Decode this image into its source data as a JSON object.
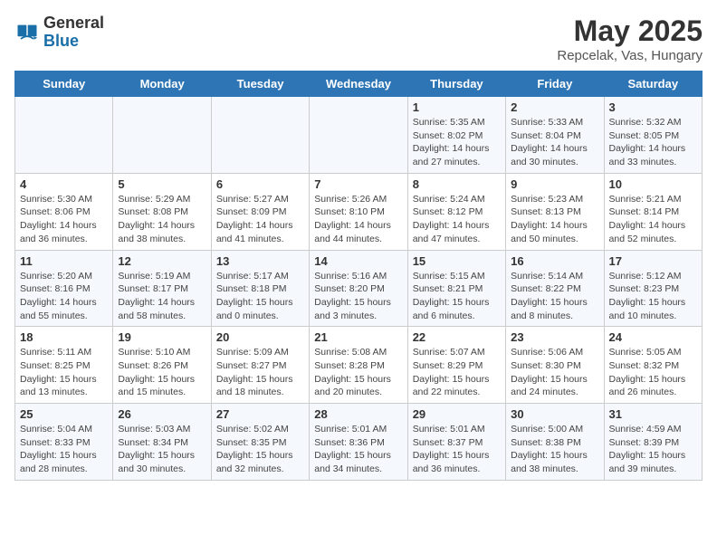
{
  "header": {
    "logo_general": "General",
    "logo_blue": "Blue",
    "title": "May 2025",
    "subtitle": "Repcelak, Vas, Hungary"
  },
  "days_of_week": [
    "Sunday",
    "Monday",
    "Tuesday",
    "Wednesday",
    "Thursday",
    "Friday",
    "Saturday"
  ],
  "weeks": [
    [
      {
        "day": "",
        "detail": ""
      },
      {
        "day": "",
        "detail": ""
      },
      {
        "day": "",
        "detail": ""
      },
      {
        "day": "",
        "detail": ""
      },
      {
        "day": "1",
        "detail": "Sunrise: 5:35 AM\nSunset: 8:02 PM\nDaylight: 14 hours and 27 minutes."
      },
      {
        "day": "2",
        "detail": "Sunrise: 5:33 AM\nSunset: 8:04 PM\nDaylight: 14 hours and 30 minutes."
      },
      {
        "day": "3",
        "detail": "Sunrise: 5:32 AM\nSunset: 8:05 PM\nDaylight: 14 hours and 33 minutes."
      }
    ],
    [
      {
        "day": "4",
        "detail": "Sunrise: 5:30 AM\nSunset: 8:06 PM\nDaylight: 14 hours and 36 minutes."
      },
      {
        "day": "5",
        "detail": "Sunrise: 5:29 AM\nSunset: 8:08 PM\nDaylight: 14 hours and 38 minutes."
      },
      {
        "day": "6",
        "detail": "Sunrise: 5:27 AM\nSunset: 8:09 PM\nDaylight: 14 hours and 41 minutes."
      },
      {
        "day": "7",
        "detail": "Sunrise: 5:26 AM\nSunset: 8:10 PM\nDaylight: 14 hours and 44 minutes."
      },
      {
        "day": "8",
        "detail": "Sunrise: 5:24 AM\nSunset: 8:12 PM\nDaylight: 14 hours and 47 minutes."
      },
      {
        "day": "9",
        "detail": "Sunrise: 5:23 AM\nSunset: 8:13 PM\nDaylight: 14 hours and 50 minutes."
      },
      {
        "day": "10",
        "detail": "Sunrise: 5:21 AM\nSunset: 8:14 PM\nDaylight: 14 hours and 52 minutes."
      }
    ],
    [
      {
        "day": "11",
        "detail": "Sunrise: 5:20 AM\nSunset: 8:16 PM\nDaylight: 14 hours and 55 minutes."
      },
      {
        "day": "12",
        "detail": "Sunrise: 5:19 AM\nSunset: 8:17 PM\nDaylight: 14 hours and 58 minutes."
      },
      {
        "day": "13",
        "detail": "Sunrise: 5:17 AM\nSunset: 8:18 PM\nDaylight: 15 hours and 0 minutes."
      },
      {
        "day": "14",
        "detail": "Sunrise: 5:16 AM\nSunset: 8:20 PM\nDaylight: 15 hours and 3 minutes."
      },
      {
        "day": "15",
        "detail": "Sunrise: 5:15 AM\nSunset: 8:21 PM\nDaylight: 15 hours and 6 minutes."
      },
      {
        "day": "16",
        "detail": "Sunrise: 5:14 AM\nSunset: 8:22 PM\nDaylight: 15 hours and 8 minutes."
      },
      {
        "day": "17",
        "detail": "Sunrise: 5:12 AM\nSunset: 8:23 PM\nDaylight: 15 hours and 10 minutes."
      }
    ],
    [
      {
        "day": "18",
        "detail": "Sunrise: 5:11 AM\nSunset: 8:25 PM\nDaylight: 15 hours and 13 minutes."
      },
      {
        "day": "19",
        "detail": "Sunrise: 5:10 AM\nSunset: 8:26 PM\nDaylight: 15 hours and 15 minutes."
      },
      {
        "day": "20",
        "detail": "Sunrise: 5:09 AM\nSunset: 8:27 PM\nDaylight: 15 hours and 18 minutes."
      },
      {
        "day": "21",
        "detail": "Sunrise: 5:08 AM\nSunset: 8:28 PM\nDaylight: 15 hours and 20 minutes."
      },
      {
        "day": "22",
        "detail": "Sunrise: 5:07 AM\nSunset: 8:29 PM\nDaylight: 15 hours and 22 minutes."
      },
      {
        "day": "23",
        "detail": "Sunrise: 5:06 AM\nSunset: 8:30 PM\nDaylight: 15 hours and 24 minutes."
      },
      {
        "day": "24",
        "detail": "Sunrise: 5:05 AM\nSunset: 8:32 PM\nDaylight: 15 hours and 26 minutes."
      }
    ],
    [
      {
        "day": "25",
        "detail": "Sunrise: 5:04 AM\nSunset: 8:33 PM\nDaylight: 15 hours and 28 minutes."
      },
      {
        "day": "26",
        "detail": "Sunrise: 5:03 AM\nSunset: 8:34 PM\nDaylight: 15 hours and 30 minutes."
      },
      {
        "day": "27",
        "detail": "Sunrise: 5:02 AM\nSunset: 8:35 PM\nDaylight: 15 hours and 32 minutes."
      },
      {
        "day": "28",
        "detail": "Sunrise: 5:01 AM\nSunset: 8:36 PM\nDaylight: 15 hours and 34 minutes."
      },
      {
        "day": "29",
        "detail": "Sunrise: 5:01 AM\nSunset: 8:37 PM\nDaylight: 15 hours and 36 minutes."
      },
      {
        "day": "30",
        "detail": "Sunrise: 5:00 AM\nSunset: 8:38 PM\nDaylight: 15 hours and 38 minutes."
      },
      {
        "day": "31",
        "detail": "Sunrise: 4:59 AM\nSunset: 8:39 PM\nDaylight: 15 hours and 39 minutes."
      }
    ]
  ]
}
